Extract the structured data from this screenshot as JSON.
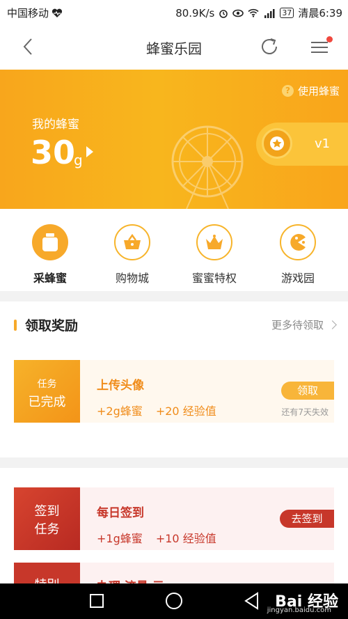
{
  "status_bar": {
    "carrier": "中国移动",
    "speed": "80.9K/s",
    "battery": "37",
    "time": "清晨6:39"
  },
  "nav": {
    "title": "蜂蜜乐园"
  },
  "hero": {
    "help_label": "使用蜂蜜",
    "my_honey_label": "我的蜂蜜",
    "amount": "30",
    "unit": "g",
    "level": "v1"
  },
  "categories": [
    {
      "label": "采蜂蜜",
      "icon": "honey-jar-icon"
    },
    {
      "label": "购物城",
      "icon": "basket-icon"
    },
    {
      "label": "蜜蜜特权",
      "icon": "crown-icon"
    },
    {
      "label": "游戏园",
      "icon": "game-icon"
    }
  ],
  "rewards": {
    "title": "领取奖励",
    "more": "更多待领取",
    "task": {
      "tag_line1": "任务",
      "tag_line2": "已完成",
      "name": "上传头像",
      "reward_honey": "+2g蜂蜜",
      "reward_exp": "+20 经验值",
      "button": "领取",
      "expire": "还有7天失效"
    }
  },
  "daily": [
    {
      "tag_line1": "签到",
      "tag_line2": "任务",
      "name": "每日签到",
      "reward_honey": "+1g蜂蜜",
      "reward_exp": "+10 经验值",
      "button": "去签到"
    },
    {
      "tag_line1": "特别",
      "name": "办理 流量 元 …"
    }
  ],
  "watermark": {
    "brand": "Bai 经验",
    "url": "jingyan.baidu.com"
  },
  "colors": {
    "accent": "#f7a92a",
    "red": "#c7372a",
    "hero": "#f8b01d"
  }
}
